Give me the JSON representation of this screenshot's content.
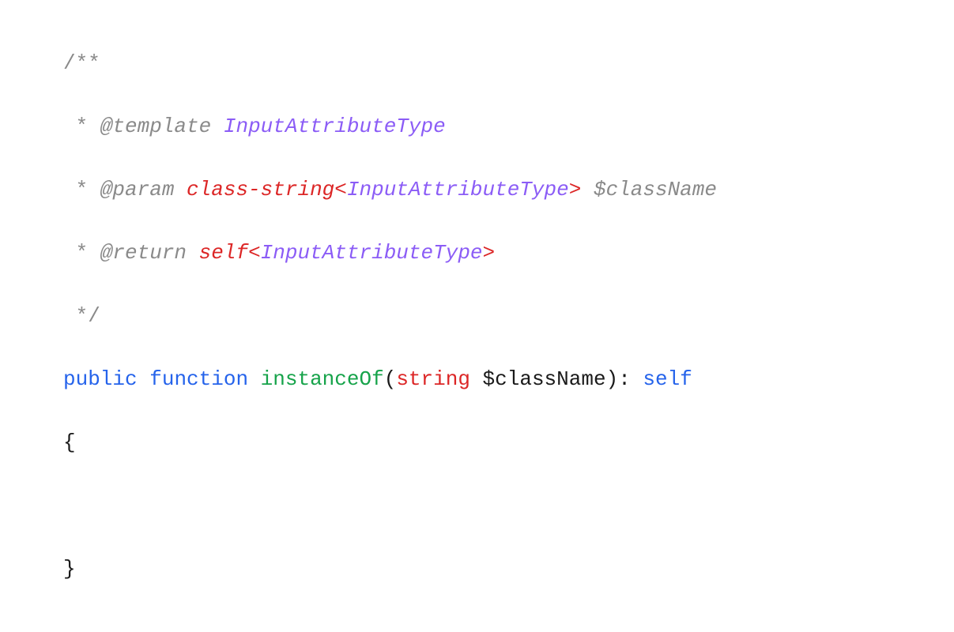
{
  "code": {
    "line1": {
      "docstart": "/**"
    },
    "line2": {
      "prefix": " * ",
      "tag": "@template",
      "space": " ",
      "type": "InputAttributeType"
    },
    "line3": {
      "prefix": " * ",
      "tag": "@param",
      "space": " ",
      "type1": "class-string",
      "lt": "<",
      "generic": "InputAttributeType",
      "gt": ">",
      "space2": " ",
      "var": "$className"
    },
    "line4": {
      "prefix": " * ",
      "tag": "@return",
      "space": " ",
      "type1": "self",
      "lt": "<",
      "generic": "InputAttributeType",
      "gt": ">"
    },
    "line5": {
      "docend": " */"
    },
    "line6": {
      "kw1": "public",
      "sp1": " ",
      "kw2": "function",
      "sp2": " ",
      "fn": "instanceOf",
      "lparen": "(",
      "ptype": "string",
      "sp3": " ",
      "pname": "$className",
      "rparen": ")",
      "colon": ": ",
      "ret": "self"
    },
    "line7": {
      "brace": "{"
    },
    "line8": {
      "empty": " "
    },
    "line9": {
      "brace": "}"
    }
  }
}
